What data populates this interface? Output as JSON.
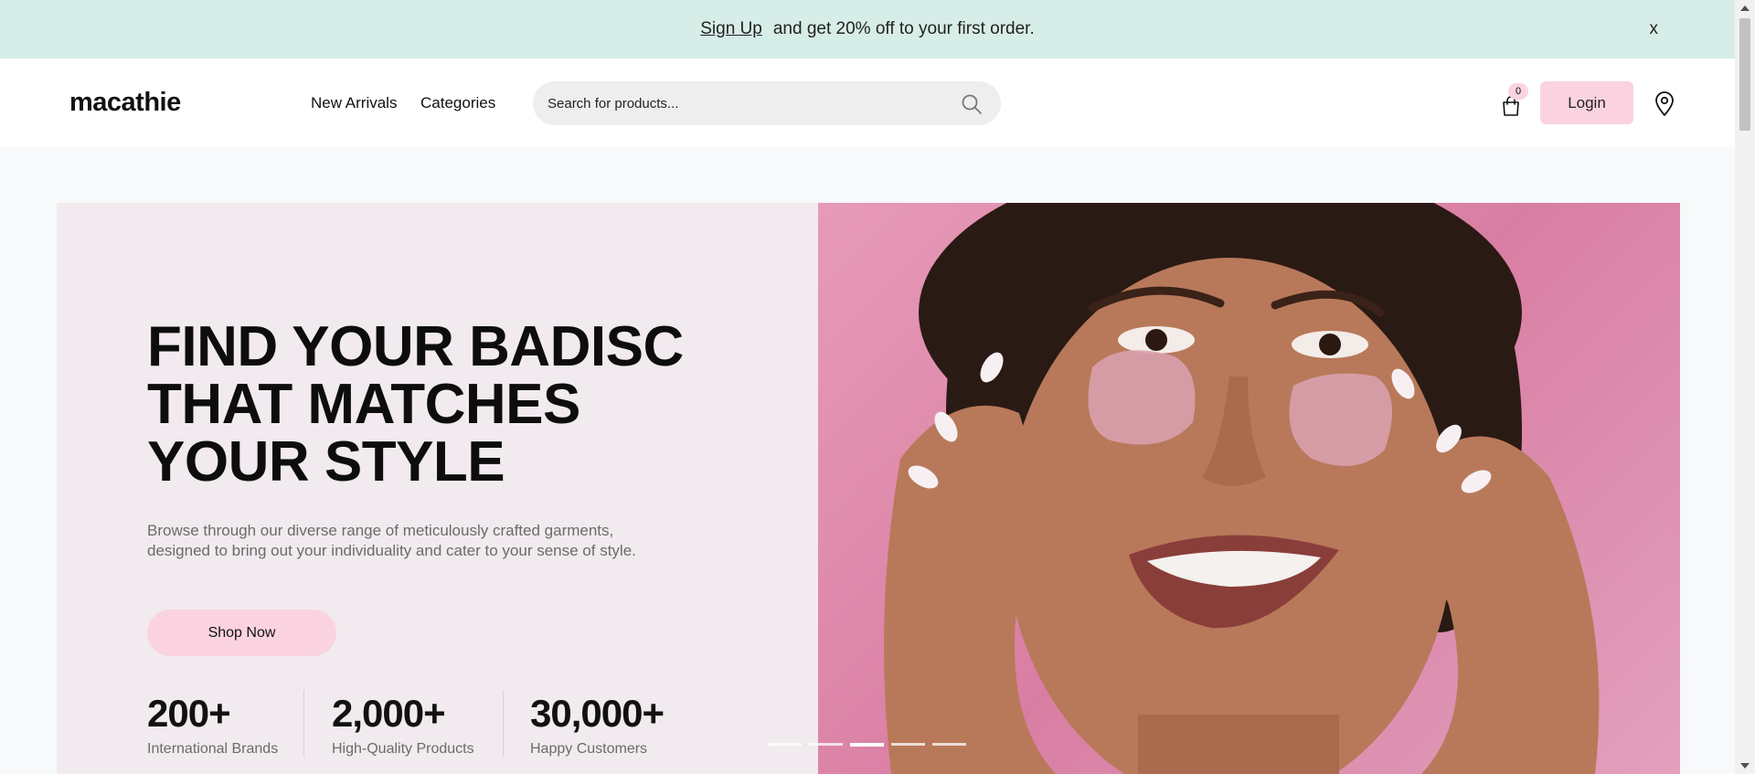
{
  "promo": {
    "link_label": "Sign Up",
    "text": "and get 20% off to your first order.",
    "close_label": "x"
  },
  "header": {
    "logo": "macathie",
    "nav": [
      "New Arrivals",
      "Categories"
    ],
    "search_placeholder": "Search for products...",
    "cart_count": "0",
    "login_label": "Login"
  },
  "hero": {
    "title_lines": [
      "FIND YOUR BADISC",
      "THAT MATCHES",
      "YOUR STYLE"
    ],
    "description": "Browse through our diverse range of meticulously crafted garments, designed to bring out your individuality and cater to your sense of style.",
    "cta_label": "Shop Now",
    "stats": [
      {
        "value": "200+",
        "label": "International Brands"
      },
      {
        "value": "2,000+",
        "label": "High-Quality Products"
      },
      {
        "value": "30,000+",
        "label": "Happy Customers"
      }
    ],
    "slides_total": 5,
    "active_slide": 3
  },
  "colors": {
    "promo_bg": "#d7ede8",
    "accent_pink": "#fbd3e0",
    "hero_bg": "#f1eaef",
    "image_bg": "#e08fb0"
  }
}
